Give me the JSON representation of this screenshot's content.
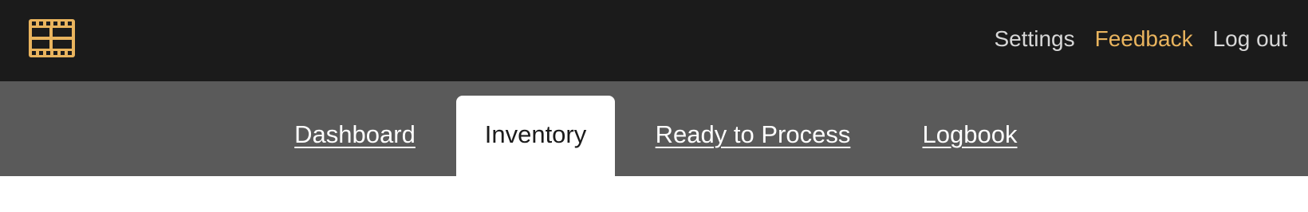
{
  "header": {
    "logo_icon": "film-icon",
    "logo_color": "#e9b45e",
    "links": [
      {
        "label": "Settings",
        "color": "#d7d7d7"
      },
      {
        "label": "Feedback",
        "color": "#e9b45e"
      },
      {
        "label": "Log out",
        "color": "#d7d7d7"
      }
    ]
  },
  "tabs": [
    {
      "label": "Dashboard",
      "active": false
    },
    {
      "label": "Inventory",
      "active": true
    },
    {
      "label": "Ready to Process",
      "active": false
    },
    {
      "label": "Logbook",
      "active": false
    }
  ],
  "colors": {
    "topbar": "#1b1b1b",
    "tabbar": "#5a5a5a",
    "active_tab": "#ffffff"
  }
}
